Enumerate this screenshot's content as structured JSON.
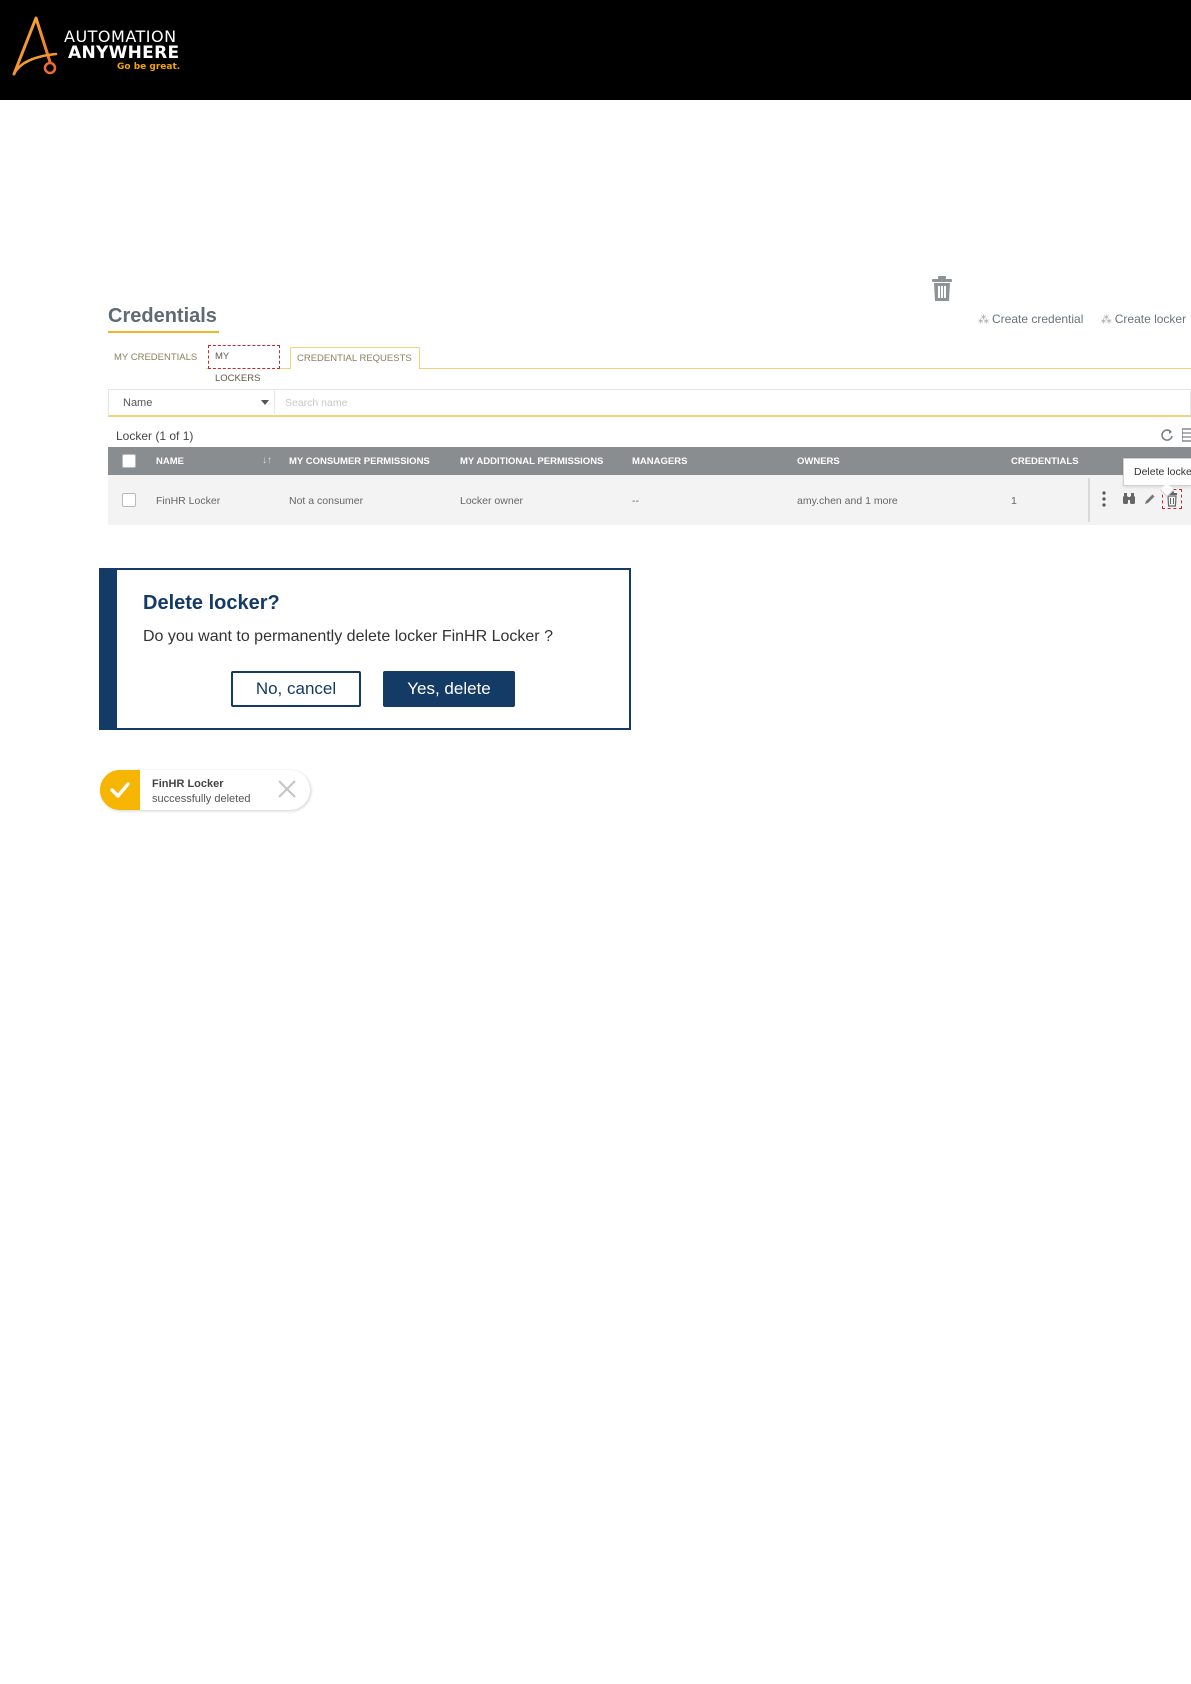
{
  "brand": {
    "line1": "AUTOMATION",
    "line2": "ANYWHERE",
    "tagline": "Go be great."
  },
  "credentials": {
    "title": "Credentials",
    "create_credential": "Create credential",
    "create_locker": "Create locker",
    "tabs": [
      {
        "label": "MY CREDENTIALS"
      },
      {
        "label": "MY LOCKERS"
      },
      {
        "label": "CREDENTIAL REQUESTS"
      }
    ],
    "filter": {
      "field": "Name",
      "placeholder": "Search name"
    },
    "count_label": "Locker (1 of 1)",
    "columns": {
      "name": "NAME",
      "consumer": "MY CONSUMER PERMISSIONS",
      "additional": "MY ADDITIONAL PERMISSIONS",
      "managers": "MANAGERS",
      "owners": "OWNERS",
      "credentials": "CREDENTIALS"
    },
    "rows": [
      {
        "name": "FinHR Locker",
        "consumer": "Not a consumer",
        "additional": "Locker owner",
        "managers": "--",
        "owners": "amy.chen and 1 more",
        "credentials": "1"
      }
    ],
    "tooltip": "Delete locker"
  },
  "dialog": {
    "title": "Delete locker?",
    "message": "Do you want to permanently delete locker FinHR Locker ?",
    "cancel_label": "No, cancel",
    "confirm_label": "Yes, delete"
  },
  "toast": {
    "title": "FinHR Locker",
    "message": "successfully deleted"
  },
  "colors": {
    "brand_orange": "#f4a300",
    "navy": "#143a66",
    "toast_yellow": "#f6b500",
    "grid_header": "#8a8d8f",
    "highlight_red": "#c62828"
  }
}
